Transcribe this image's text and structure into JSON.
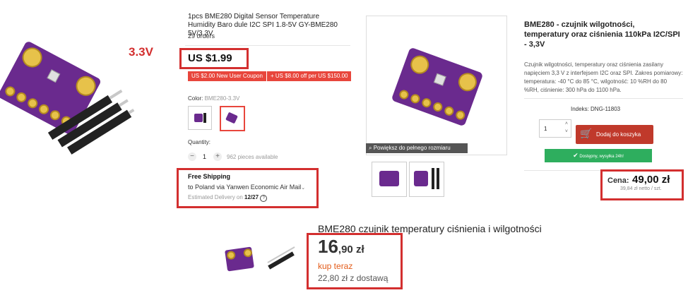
{
  "panel1": {
    "voltage_label": "3.3V",
    "colors": {
      "pcb": "#6a2a8e",
      "pads": "#e7c24a",
      "label": "#d32f2f"
    }
  },
  "panel2": {
    "title": "1pcs BME280 Digital Sensor Temperature Humidity Baro dule I2C SPI 1.8-5V GY-BME280 5V/3.3V",
    "orders": "29 orders",
    "price": "US $1.99",
    "coupon1": "US $2.00 New User Coupon",
    "coupon2": "+ US $8.00 off per US $150.00",
    "color_label": "Color:",
    "color_value": "BME280-3.3V",
    "quantity_label": "Quantity:",
    "qty_minus": "−",
    "qty_value": "1",
    "qty_plus": "+",
    "available": "962 pieces available",
    "shipping_title": "Free Shipping",
    "shipping_to": "to Poland via Yanwen Economic Air Mail",
    "delivery_prefix": "Estimated Delivery on",
    "delivery_date": "12/27"
  },
  "panel3": {
    "zoom_label": "Powiększ do pełnego rozmiaru"
  },
  "panel4": {
    "title": "BME280 - czujnik wilgotności, temperatury oraz ciśnienia 110kPa I2C/SPI - 3,3V",
    "description": "Czujnik wilgotności, temperatury oraz ciśnienia zasilany napięciem 3,3 V z interfejsem I2C oraz SPI. Zakres pomiarowy: temperatura: -40 °C do 85 °C, wilgotność: 10 %RH do 80 %RH, ciśnienie: 300 hPa do 1100 hPa.",
    "index": "Indeks: DNG-11803",
    "qty_value": "1",
    "add_to_cart": "Dodaj do koszyka",
    "availability": "Dostępny, wysyłka 24h!",
    "price_label": "Cena:",
    "price": "49,00 zł",
    "net_price": "39,84 zł netto / szt."
  },
  "panel5": {
    "title": "BME280 czujnik temperatury ciśnienia i wilgotności",
    "price_main": "16",
    "price_decimal": ",90 zł",
    "buy_now": "kup teraz",
    "shipping_price": "22,80 zł z dostawą"
  }
}
